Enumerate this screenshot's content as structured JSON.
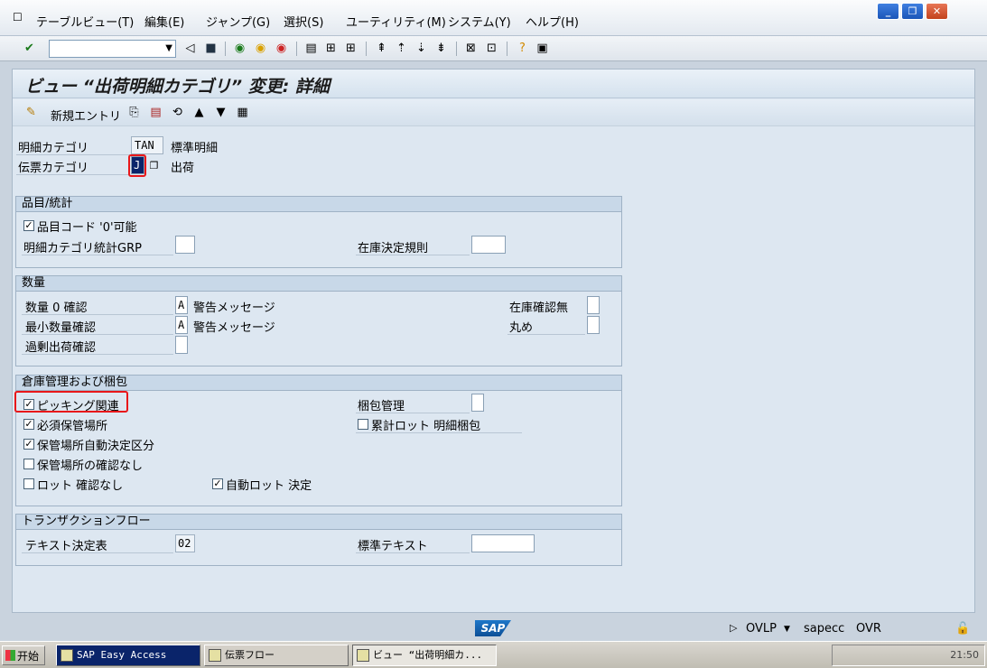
{
  "menubar": {
    "items": [
      "テーブルビュー(T)",
      "編集(E)",
      "ジャンプ(G)",
      "選択(S)",
      "ユーティリティ(M)",
      "システム(Y)",
      "ヘルプ(H)"
    ]
  },
  "toolbar": {
    "command_value": ""
  },
  "screen": {
    "title": "ビュー “出荷明細カテゴリ” 変更: 詳細",
    "new_entries_label": "新規エントリ"
  },
  "header_fields": {
    "item_category_label": "明細カテゴリ",
    "item_category_value": "TAN",
    "item_category_desc": "標準明細",
    "doc_category_label": "伝票カテゴリ",
    "doc_category_value": "J",
    "doc_category_desc": "出荷"
  },
  "material_stats": {
    "title": "品目/統計",
    "material_zero_label": "品目コード '0'可能",
    "material_zero_checked": true,
    "stat_grp_label": "明細カテゴリ統計GRP",
    "stat_grp_value": "",
    "stock_rule_label": "在庫決定規則",
    "stock_rule_value": ""
  },
  "quantity": {
    "title": "数量",
    "qty_zero_label": "数量 0 確認",
    "qty_zero_value": "A",
    "qty_zero_desc": "警告メッセージ",
    "min_qty_label": "最小数量確認",
    "min_qty_value": "A",
    "min_qty_desc": "警告メッセージ",
    "overdelivery_label": "過剰出荷確認",
    "overdelivery_value": "",
    "no_avail_check_label": "在庫確認無",
    "no_avail_check_value": "",
    "rounding_label": "丸め",
    "rounding_value": ""
  },
  "warehouse": {
    "title": "倉庫管理および梱包",
    "picking_label": "ピッキング関連",
    "picking_checked": true,
    "storage_req_label": "必須保管場所",
    "storage_req_checked": true,
    "storage_auto_label": "保管場所自動決定区分",
    "storage_auto_checked": true,
    "no_storage_check_label": "保管場所の確認なし",
    "no_storage_check_checked": false,
    "no_batch_check_label": "ロット 確認なし",
    "no_batch_check_checked": false,
    "auto_batch_label": "自動ロット 決定",
    "auto_batch_checked": true,
    "packing_label": "梱包管理",
    "packing_value": "",
    "cum_batch_label": "累計ロット 明細梱包",
    "cum_batch_checked": false
  },
  "transaction": {
    "title": "トランザクションフロー",
    "text_proc_label": "テキスト決定表",
    "text_proc_value": "02",
    "std_text_label": "標準テキスト",
    "std_text_value": ""
  },
  "statusbar": {
    "sap_logo": "SAP",
    "mode": "OVLP",
    "server": "sapecc",
    "insert_mode": "OVR"
  },
  "taskbar": {
    "start_label": "开始",
    "tasks": [
      "SAP Easy Access",
      "伝票フロー",
      "ビュー “出荷明細カ..."
    ],
    "clock": "21:50"
  }
}
